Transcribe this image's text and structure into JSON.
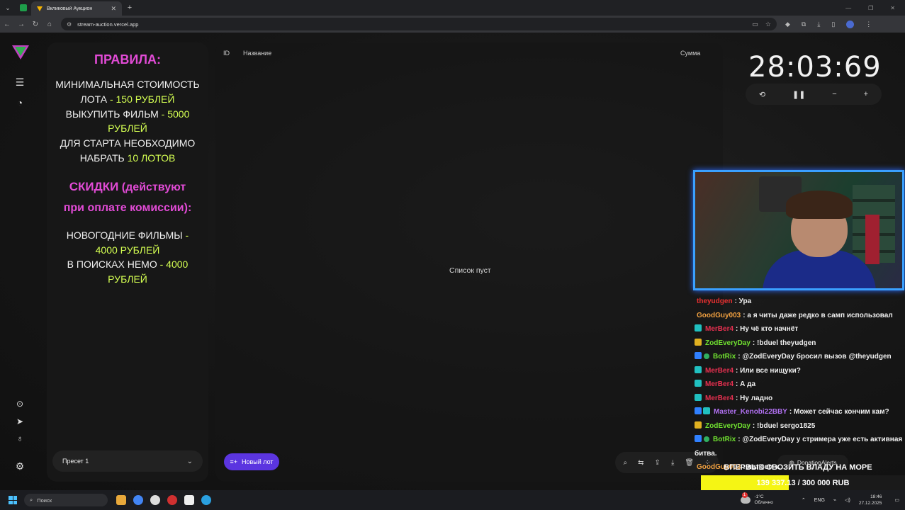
{
  "browser": {
    "tab_title": "Вкликовый Аукцион",
    "url": "stream-auction.vercel.app"
  },
  "rules": {
    "heading": "ПРАВИЛА:",
    "lines": [
      {
        "text": "МИНИМАЛЬНАЯ СТОИМОСТЬ",
        "hl": ""
      },
      {
        "text": "ЛОТА",
        "hl": " - 150 РУБЛЕЙ"
      },
      {
        "text": "ВЫКУПИТЬ ФИЛЬМ",
        "hl": " - 5000"
      },
      {
        "text": "",
        "hl": "РУБЛЕЙ"
      },
      {
        "text": "ДЛЯ СТАРТА НЕОБХОДИМО",
        "hl": ""
      },
      {
        "text": "НАБРАТЬ",
        "hl": " 10 ЛОТОВ"
      }
    ],
    "discounts_heading": "СКИДКИ",
    "discounts_note": " (действуют",
    "discounts_note2": "при оплате комиссии):",
    "discount_lines": [
      {
        "text": "НОВОГОДНИЕ ФИЛЬМЫ",
        "hl": " -"
      },
      {
        "text": "",
        "hl": "4000 РУБЛЕЙ"
      },
      {
        "text": "В ПОИСКАХ НЕМО",
        "hl": " - 4000"
      },
      {
        "text": "",
        "hl": "РУБЛЕЙ"
      }
    ]
  },
  "preset": {
    "label": "Пресет 1"
  },
  "table": {
    "col_id": "ID",
    "col_name": "Название",
    "col_sum": "Сумма",
    "empty": "Список пуст"
  },
  "new_lot_label": "Новый лот",
  "timer": {
    "minutes": "28",
    "seconds": "03",
    "hundredths": "69"
  },
  "chat": [
    {
      "user": "theyudgen",
      "color": "#e83030",
      "badges": [],
      "text": ": Ура"
    },
    {
      "user": "GoodGuy003",
      "color": "#f0a040",
      "badges": [],
      "text": ": а я читы даже редко в самп использовал"
    },
    {
      "user": "MerBer4",
      "color": "#e83050",
      "badges": [
        "cyan"
      ],
      "text": ": Ну чё кто начнёт"
    },
    {
      "user": "ZodEveryDay",
      "color": "#70e030",
      "badges": [
        "gold"
      ],
      "text": ": !bduel theyudgen"
    },
    {
      "user": "BotRix",
      "color": "#70e030",
      "badges": [
        "blue",
        "check"
      ],
      "text": ": @ZodEveryDay бросил вызов @theyudgen"
    },
    {
      "user": "MerBer4",
      "color": "#e83050",
      "badges": [
        "cyan"
      ],
      "text": ": Или все нищуки?"
    },
    {
      "user": "MerBer4",
      "color": "#e83050",
      "badges": [
        "cyan"
      ],
      "text": ": А да"
    },
    {
      "user": "MerBer4",
      "color": "#e83050",
      "badges": [
        "cyan"
      ],
      "text": ": Ну ладно"
    },
    {
      "user": "Master_Kenobi22BBY",
      "color": "#b070f0",
      "badges": [
        "blue",
        "cyan"
      ],
      "text": ": Может сейчас кончим кам?"
    },
    {
      "user": "ZodEveryDay",
      "color": "#70e030",
      "badges": [
        "gold"
      ],
      "text": ": !bduel sergo1825"
    },
    {
      "user": "BotRix",
      "color": "#70e030",
      "badges": [
        "blue",
        "check"
      ],
      "text": ": @ZodEveryDay у стримера уже есть активная"
    },
    {
      "user": "",
      "color": "#f0f0f0",
      "badges": [],
      "text": "битва."
    },
    {
      "user": "GoodGuy003",
      "color": "#f0a040",
      "badges": [],
      "text": ": лет зем кам"
    }
  ],
  "donation": {
    "service": "DonationAlerts",
    "goal_title": "ВПЕРВЫЕ СВОЗИТЬ ВЛАДУ НА МОРЕ",
    "current": "139 337.13",
    "target": "300 000 RUB",
    "fill_fraction": 0.43
  },
  "taskbar": {
    "search": "Поиск",
    "temp": "-1°C",
    "weather": "Облачно",
    "weather_badge": "1",
    "lang": "ENG",
    "time": "18:46",
    "date": "27.12.2025"
  }
}
